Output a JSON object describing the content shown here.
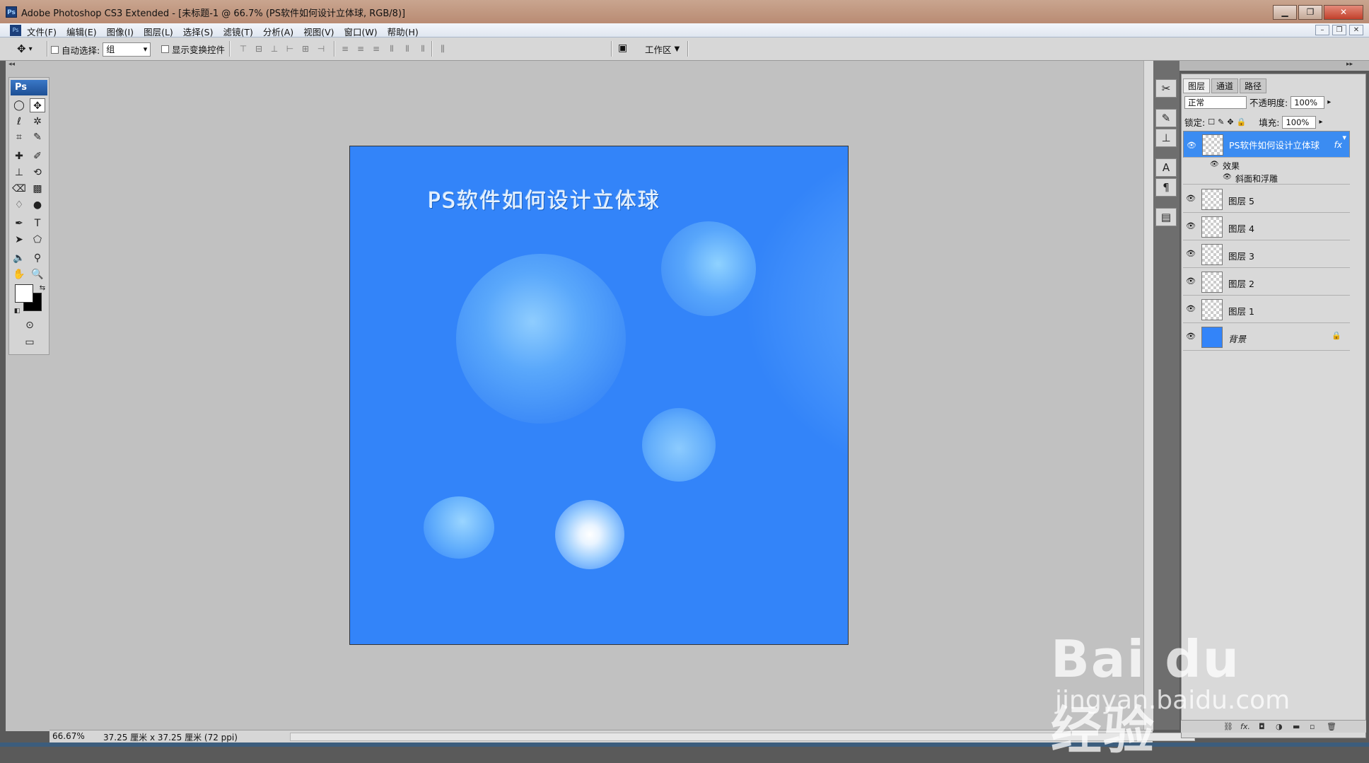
{
  "window": {
    "title": "Adobe Photoshop CS3 Extended - [未标题-1 @ 66.7% (PS软件如何设计立体球, RGB/8)]",
    "app_icon": "Ps",
    "min": "▁",
    "max": "❐",
    "close": "✕"
  },
  "menu": [
    "文件(F)",
    "编辑(E)",
    "图像(I)",
    "图层(L)",
    "选择(S)",
    "滤镜(T)",
    "分析(A)",
    "视图(V)",
    "窗口(W)",
    "帮助(H)"
  ],
  "options": {
    "auto_select_label": "自动选择:",
    "auto_select_value": "组",
    "show_transform_label": "显示变换控件",
    "workspace_label": "工作区"
  },
  "toolbox": {
    "header": "Ps"
  },
  "canvas": {
    "heading": "PS软件如何设计立体球",
    "background_color": "#3384f9"
  },
  "status": {
    "zoom": "66.67%",
    "doc_info": "37.25 厘米 x 37.25 厘米 (72 ppi)"
  },
  "layers_panel": {
    "tabs": [
      "图层",
      "通道",
      "路径"
    ],
    "blend_mode": "正常",
    "opacity_label": "不透明度:",
    "opacity_value": "100%",
    "lock_label": "锁定:",
    "fill_label": "填充:",
    "fill_value": "100%",
    "effects_label": "效果",
    "bevel_label": "斜面和浮雕",
    "fx": "fx",
    "layers": [
      {
        "name": "PS软件如何设计立体球"
      },
      {
        "name": "图层 5"
      },
      {
        "name": "图层 4"
      },
      {
        "name": "图层 3"
      },
      {
        "name": "图层 2"
      },
      {
        "name": "图层 1"
      },
      {
        "name": "背景"
      }
    ]
  },
  "watermark": {
    "line1": "Bai du 经验",
    "line2": "jingyan.baidu.com"
  },
  "colors": {
    "selection": "#3b8cf2",
    "title_bar": "#c9a58f"
  }
}
